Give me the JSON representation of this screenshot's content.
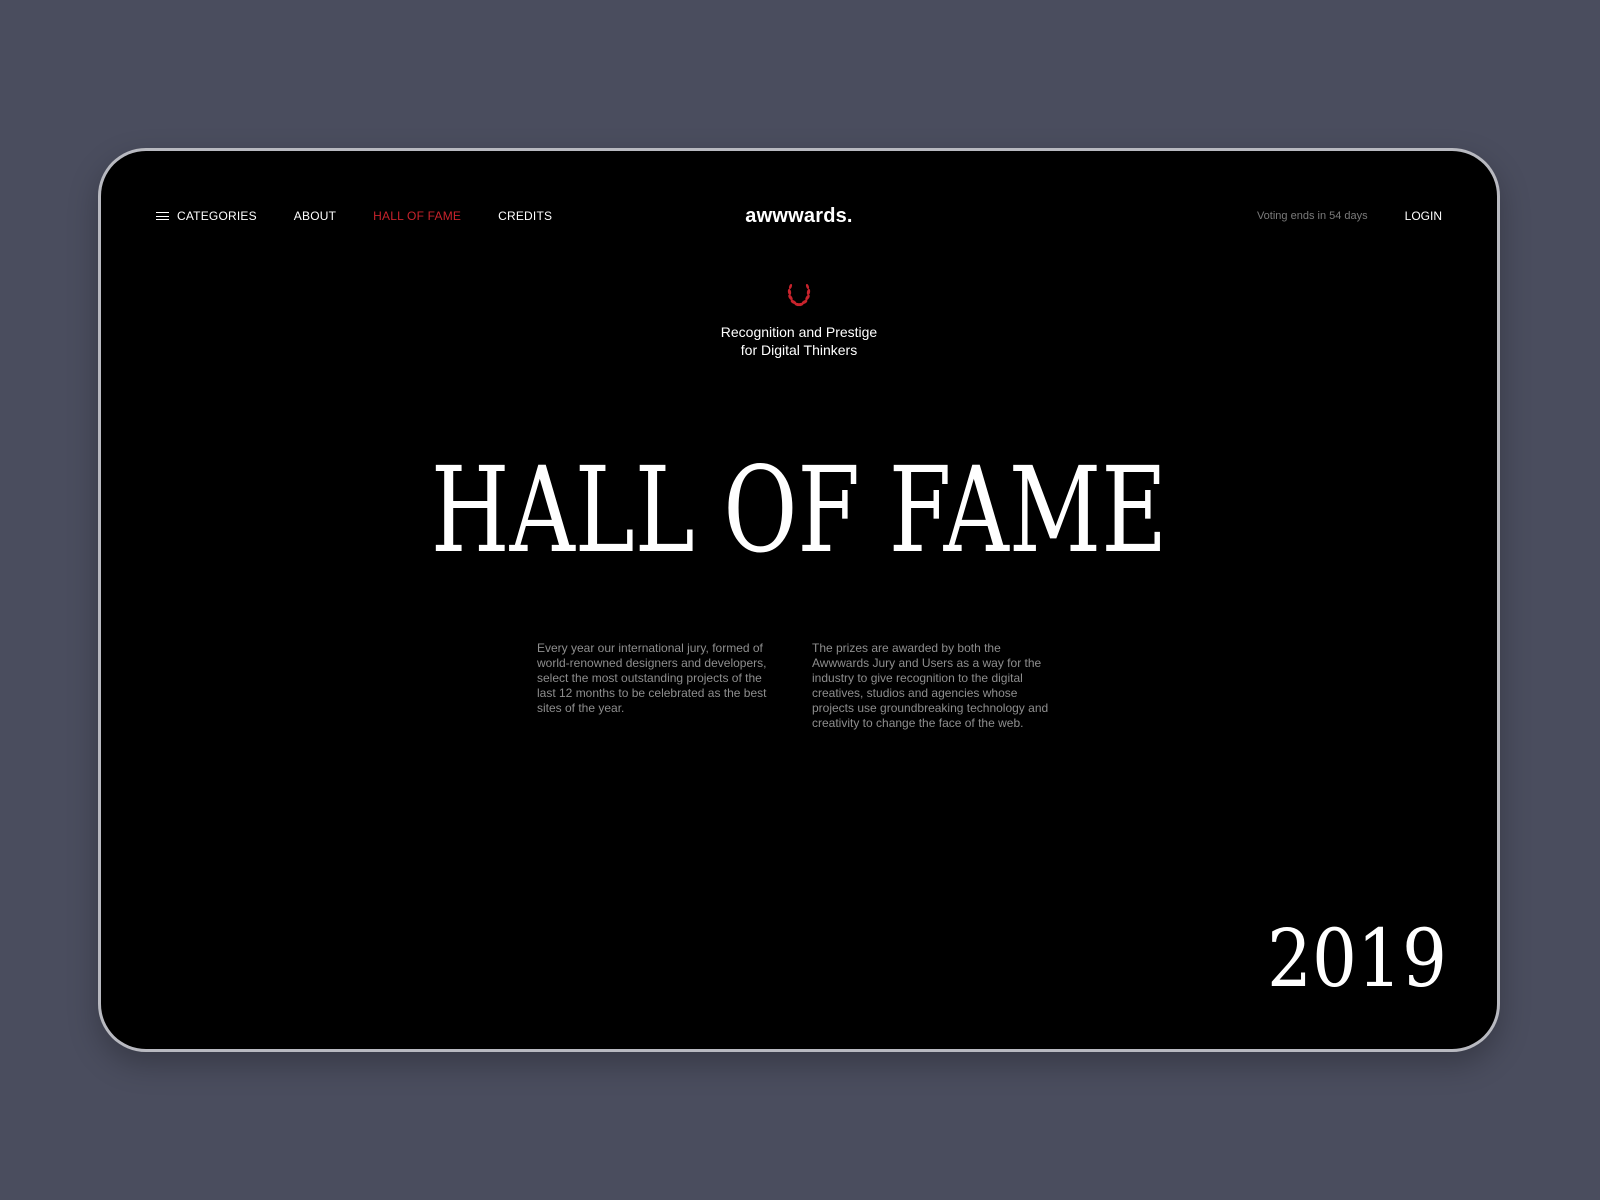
{
  "nav": {
    "items": [
      {
        "label": "CATEGORIES"
      },
      {
        "label": "ABOUT"
      },
      {
        "label": "HALL OF FAME"
      },
      {
        "label": "CREDITS"
      }
    ],
    "active_color": "#c8232c"
  },
  "brand": {
    "logo": "awwwards."
  },
  "status": {
    "voting": "Voting ends in 54 days"
  },
  "account": {
    "login_label": "LOGIN"
  },
  "hero": {
    "icon": "laurel-icon",
    "tagline_line1": "Recognition and Prestige",
    "tagline_line2": "for Digital Thinkers",
    "title": "HALL OF FAME",
    "paragraph_left": "Every year our international jury, formed of world-renowned designers and developers, select the most outstanding projects of the last 12 months to be celebrated as the best sites of the year.",
    "paragraph_right": "The prizes are awarded by both the Awwwards Jury and Users as a way for the industry to give recognition to the digital creatives, studios and agencies whose projects use groundbreaking technology and creativity to change the face of the web.",
    "year": "2019"
  },
  "colors": {
    "page_background": "#4a4d5e",
    "screen_background": "#000000",
    "accent": "#c8232c",
    "text_primary": "#ffffff",
    "text_muted": "#8e8e8e"
  }
}
